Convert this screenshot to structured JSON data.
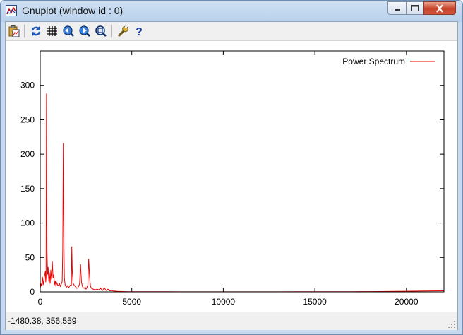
{
  "window": {
    "title": "Gnuplot (window id : 0)"
  },
  "toolbar": {
    "buttons": [
      {
        "name": "copy-to-clipboard-button",
        "icon": "clipboard-icon"
      },
      {
        "name": "replot-button",
        "icon": "refresh-icon"
      },
      {
        "name": "toggle-grid-button",
        "icon": "grid-icon"
      },
      {
        "name": "previous-zoom-button",
        "icon": "zoom-previous-icon"
      },
      {
        "name": "next-zoom-button",
        "icon": "zoom-next-icon"
      },
      {
        "name": "autoscale-button",
        "icon": "zoom-autoscale-icon"
      },
      {
        "name": "options-button",
        "icon": "wrench-icon"
      },
      {
        "name": "help-button",
        "icon": "help-icon"
      }
    ]
  },
  "status": {
    "coordinates": "-1480.38,  356.559"
  },
  "colors": {
    "series": "#ee0000",
    "axis": "#000000"
  },
  "chart_data": {
    "type": "line",
    "title": "",
    "xlabel": "",
    "ylabel": "",
    "xlim": [
      0,
      22050
    ],
    "ylim": [
      0,
      350
    ],
    "xticks": [
      0,
      5000,
      10000,
      15000,
      20000
    ],
    "xtick_labels": [
      "0",
      "5000",
      "10000",
      "15000",
      "20000"
    ],
    "yticks": [
      0,
      50,
      100,
      150,
      200,
      250,
      300
    ],
    "ytick_labels": [
      "0",
      "50",
      "100",
      "150",
      "200",
      "250",
      "300"
    ],
    "grid": false,
    "legend": "top-right",
    "series": [
      {
        "name": "Power Spectrum",
        "color": "#ee0000",
        "x": [
          0,
          40,
          80,
          120,
          160,
          200,
          240,
          280,
          300,
          320,
          345,
          370,
          400,
          430,
          470,
          500,
          540,
          580,
          620,
          660,
          700,
          740,
          780,
          820,
          860,
          900,
          950,
          1000,
          1050,
          1100,
          1150,
          1200,
          1230,
          1260,
          1290,
          1320,
          1360,
          1400,
          1450,
          1500,
          1550,
          1600,
          1650,
          1700,
          1725,
          1750,
          1800,
          1850,
          1900,
          1950,
          2000,
          2050,
          2100,
          2150,
          2200,
          2250,
          2300,
          2350,
          2400,
          2450,
          2500,
          2550,
          2600,
          2650,
          2700,
          2750,
          2800,
          2900,
          3000,
          3100,
          3200,
          3300,
          3400,
          3500,
          3600,
          3700,
          3800,
          3900,
          4000,
          4200,
          4400,
          4600,
          4800,
          5000,
          5500,
          6000,
          6500,
          7000,
          8000,
          9000,
          10000,
          11000,
          12000,
          13000,
          14000,
          15000,
          16000,
          17000,
          18000,
          19000,
          20000,
          21000,
          22050
        ],
        "y": [
          5,
          12,
          8,
          22,
          10,
          18,
          24,
          30,
          14,
          22,
          288,
          60,
          25,
          36,
          15,
          28,
          12,
          32,
          18,
          44,
          20,
          25,
          10,
          16,
          8,
          14,
          10,
          9,
          12,
          8,
          11,
          15,
          60,
          216,
          70,
          20,
          10,
          8,
          7,
          9,
          6,
          8,
          10,
          9,
          66,
          30,
          12,
          10,
          8,
          7,
          5,
          6,
          8,
          12,
          40,
          15,
          8,
          6,
          5,
          7,
          4,
          6,
          10,
          48,
          20,
          8,
          5,
          4,
          3,
          4,
          3,
          5,
          2,
          6,
          2,
          4,
          1.5,
          2,
          1.2,
          0.8,
          0.6,
          0.4,
          0.3,
          0.3,
          0.2,
          0.2,
          0.2,
          0.2,
          0.15,
          0.15,
          0.15,
          0.15,
          0.15,
          0.15,
          0.2,
          0.2,
          0.2,
          0.3,
          0.4,
          0.6,
          0.9,
          1.2,
          1.5
        ]
      }
    ]
  }
}
